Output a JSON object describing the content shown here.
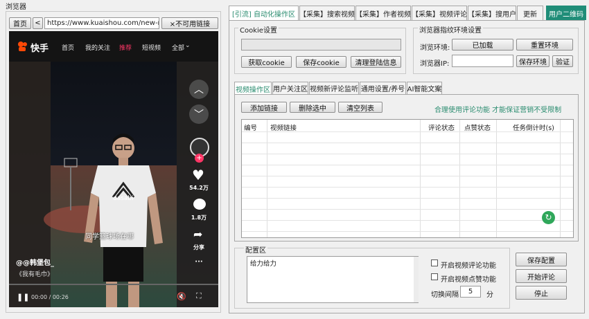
{
  "window": {
    "title": "浏览器"
  },
  "browser": {
    "home": "首页",
    "back": "<",
    "url": "https://www.kuaishou.com/new-reco",
    "blocked": "×不可用链接"
  },
  "site": {
    "logo": "快手",
    "nav": [
      "首页",
      "我的关注",
      "推荐",
      "短视频",
      "全部"
    ]
  },
  "video": {
    "subtitle": "同学篮球场在哪",
    "author": "@@韩堡包_",
    "music": "《我有毛巾》",
    "likes": "54.2万",
    "comments": "1.8万",
    "share": "分享",
    "more": "···",
    "time": "00:00 / 00:26",
    "shirt_text": "dasabi"
  },
  "tabs": [
    "[引流] 自动化操作区",
    "【采集】搜索视频",
    "【采集】作者视频",
    "【采集】视频评论",
    "【采集】搜用户",
    "更新",
    "用户二维码"
  ],
  "cookie": {
    "title": "Cookie设置",
    "value": "",
    "get": "获取cookie",
    "save": "保存cookie",
    "clear": "清理登陆信息"
  },
  "env": {
    "title": "浏览器指纹环境设置",
    "env_label": "浏览环境:",
    "env_status": "已加载",
    "reset": "重置环境",
    "ip_label": "浏览器IP:",
    "ip_value": "",
    "save_env": "保存环境",
    "verify": "验证"
  },
  "subtabs": [
    "视频操作区",
    "用户关注区",
    "视频新评论监听",
    "通用设置/养号",
    "AI智能文案"
  ],
  "list": {
    "add": "添加链接",
    "delete": "删除选中",
    "clear": "清空列表",
    "notice": "合理使用评论功能 才能保证营销不受限制",
    "columns": [
      "编号",
      "视频链接",
      "评论状态",
      "点赞状态",
      "任务倒计时(s)"
    ]
  },
  "config": {
    "title": "配置区",
    "text": "给力给力",
    "enable_comment": "开启视频评论功能",
    "enable_like": "开启视频点赞功能",
    "interval_label": "切换间隔",
    "interval_value": "5",
    "interval_unit": "分",
    "save": "保存配置",
    "start": "开始评论",
    "stop": "停止"
  },
  "colors": {
    "accent": "#1f8d78",
    "nav_active": "#fe3666",
    "notice": "#2a8c6f"
  }
}
